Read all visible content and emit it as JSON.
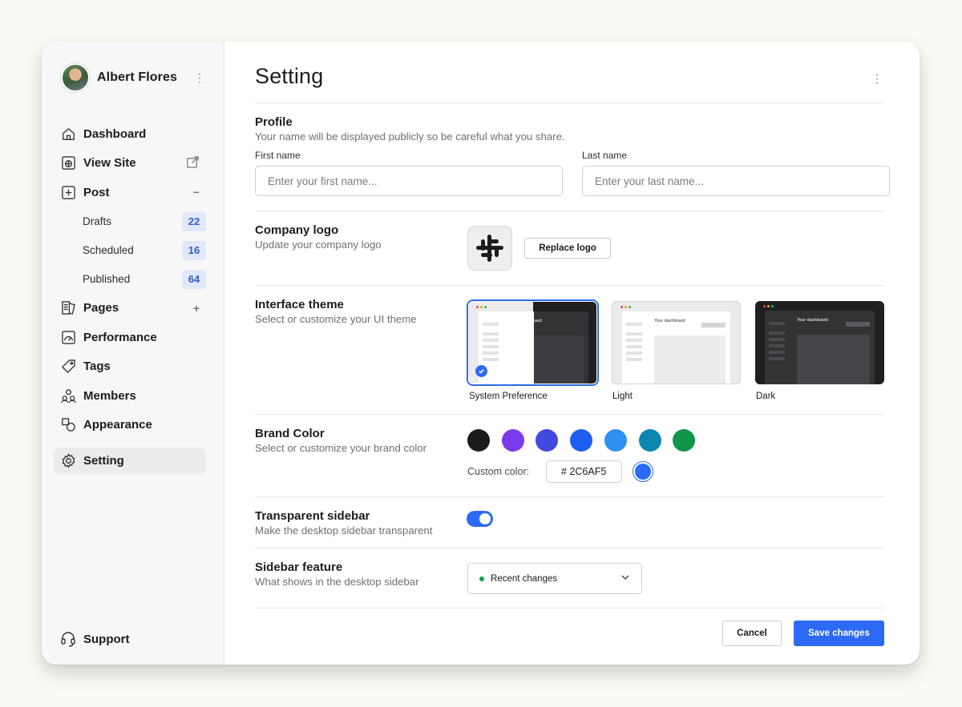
{
  "user": {
    "name": "Albert Flores"
  },
  "nav": {
    "dashboard": "Dashboard",
    "view_site": "View Site",
    "post": "Post",
    "post_sub": [
      {
        "label": "Drafts",
        "count": "22"
      },
      {
        "label": "Scheduled",
        "count": "16"
      },
      {
        "label": "Published",
        "count": "64"
      }
    ],
    "pages": "Pages",
    "performance": "Performance",
    "tags": "Tags",
    "members": "Members",
    "appearance": "Appearance",
    "setting": "Setting",
    "support": "Support"
  },
  "page": {
    "title": "Setting"
  },
  "profile": {
    "title": "Profile",
    "desc": "Your name will be displayed publicly so be careful what you share.",
    "first_label": "First name",
    "first_placeholder": "Enter your first name...",
    "last_label": "Last name",
    "last_placeholder": "Enter your last name..."
  },
  "logo": {
    "title": "Company logo",
    "desc": "Update your company logo",
    "replace": "Replace logo"
  },
  "theme": {
    "title": "Interface theme",
    "desc": "Select or customize your UI theme",
    "options": [
      {
        "label": "System Preference",
        "mini_text": "Your dashboard"
      },
      {
        "label": "Light",
        "mini_text": "Your dashboard"
      },
      {
        "label": "Dark",
        "mini_text": "Your dashboard"
      }
    ],
    "selected": "System Preference"
  },
  "brand": {
    "title": "Brand Color",
    "desc": "Select or customize your brand color",
    "swatches": [
      "#1c1c1e",
      "#7c3aed",
      "#4348e0",
      "#1e5ef0",
      "#2f8ff2",
      "#0a86b0",
      "#0f9648"
    ],
    "custom_label": "Custom color:",
    "custom_value": "# 2C6AF5",
    "custom_color": "#2c6af5"
  },
  "transparent": {
    "title": "Transparent sidebar",
    "desc": "Make the desktop sidebar transparent",
    "enabled": true
  },
  "feature": {
    "title": "Sidebar feature",
    "desc": "What shows in the desktop sidebar",
    "value": "Recent changes"
  },
  "actions": {
    "cancel": "Cancel",
    "save": "Save changes"
  },
  "colors": {
    "accent": "#2c6af5",
    "badge_bg": "#e1e8fb",
    "badge_text": "#2c5fd8"
  }
}
